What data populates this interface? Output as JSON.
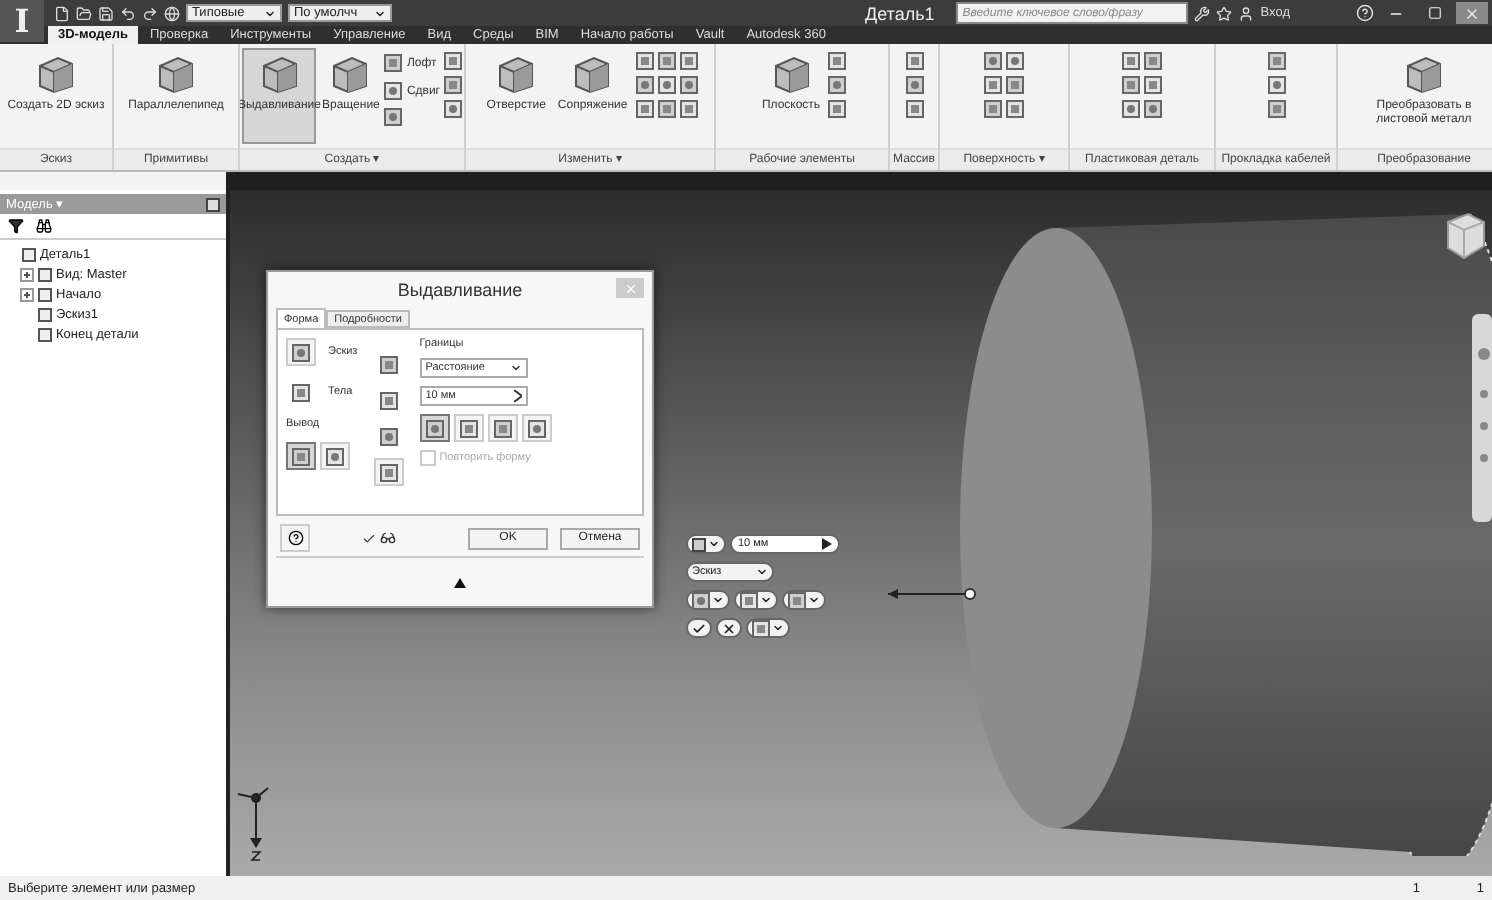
{
  "title_bar": {
    "app_button": "I",
    "style_dropdown": "Типовые",
    "appearance_dropdown": "По умолчч",
    "title": "Деталь1",
    "search": {
      "placeholder": "Введите ключевое слово/фразу"
    },
    "sign_in": "Вход"
  },
  "tabs": [
    {
      "label": "3D-модель",
      "selected": true
    },
    {
      "label": "Проверка",
      "selected": false
    },
    {
      "label": "Инструменты",
      "selected": false
    },
    {
      "label": "Управление",
      "selected": false
    },
    {
      "label": "Вид",
      "selected": false
    },
    {
      "label": "Среды",
      "selected": false
    },
    {
      "label": "BIM",
      "selected": false
    },
    {
      "label": "Начало работы",
      "selected": false
    },
    {
      "label": "Vault",
      "selected": false
    },
    {
      "label": "Autodesk 360",
      "selected": false
    }
  ],
  "ribbon": [
    {
      "title": "Эскиз",
      "items": [
        {
          "kind": "large",
          "label": "Создать 2D эскиз",
          "active": false
        }
      ]
    },
    {
      "title": "Примитивы",
      "items": [
        {
          "kind": "large",
          "label": "Параллелепипед",
          "active": false
        }
      ]
    },
    {
      "title": "Создать ▾",
      "items": [
        {
          "kind": "large",
          "label": "Выдавливание",
          "active": true
        },
        {
          "kind": "large",
          "label": "Вращение",
          "active": false
        },
        {
          "kind": "small",
          "label": "Лофт"
        },
        {
          "kind": "small",
          "label": "Сдвиг"
        },
        {
          "kind": "small"
        },
        {
          "kind": "small"
        },
        {
          "kind": "small"
        },
        {
          "kind": "small"
        }
      ]
    },
    {
      "title": "Изменить ▾",
      "items": [
        {
          "kind": "large",
          "label": "Отверстие",
          "active": false
        },
        {
          "kind": "large",
          "label": "Сопряжение",
          "active": false
        },
        {
          "kind": "small"
        },
        {
          "kind": "small"
        },
        {
          "kind": "small"
        },
        {
          "kind": "small"
        },
        {
          "kind": "small"
        },
        {
          "kind": "small"
        },
        {
          "kind": "small"
        },
        {
          "kind": "small"
        },
        {
          "kind": "small"
        }
      ]
    },
    {
      "title": "Рабочие элементы",
      "items": [
        {
          "kind": "large",
          "label": "Плоскость",
          "active": false
        },
        {
          "kind": "small"
        },
        {
          "kind": "small"
        },
        {
          "kind": "small"
        }
      ]
    },
    {
      "title": "Массив",
      "items": [
        {
          "kind": "small"
        },
        {
          "kind": "small"
        },
        {
          "kind": "small"
        }
      ]
    },
    {
      "title": "Поверхность ▾",
      "items": [
        {
          "kind": "small"
        },
        {
          "kind": "small"
        },
        {
          "kind": "small"
        },
        {
          "kind": "small"
        },
        {
          "kind": "small"
        },
        {
          "kind": "small"
        }
      ]
    },
    {
      "title": "Пластиковая деталь",
      "items": [
        {
          "kind": "small"
        },
        {
          "kind": "small"
        },
        {
          "kind": "small"
        },
        {
          "kind": "small"
        },
        {
          "kind": "small"
        },
        {
          "kind": "small"
        }
      ]
    },
    {
      "title": "Прокладка кабелей",
      "items": [
        {
          "kind": "small"
        },
        {
          "kind": "small"
        },
        {
          "kind": "small"
        }
      ]
    },
    {
      "title": "Преобразование",
      "items": [
        {
          "kind": "large",
          "label": "Преобразовать в листовой металл",
          "active": false
        }
      ]
    }
  ],
  "browser": {
    "header": "Модель ▾",
    "tree": [
      {
        "label": "Деталь1",
        "children": [
          {
            "label": "Вид: Master",
            "expanded": false
          },
          {
            "label": "Начало",
            "expanded": false
          },
          {
            "label": "Эскиз1"
          },
          {
            "label": "Конец детали"
          }
        ]
      }
    ]
  },
  "dialog": {
    "title": "Выдавливание",
    "tabs": [
      {
        "label": "Форма",
        "selected": true
      },
      {
        "label": "Подробности",
        "selected": false
      }
    ],
    "profile_label": "Эскиз",
    "solids_label": "Тела",
    "output_label": "Вывод",
    "output": [
      {
        "selected": true
      },
      {
        "selected": false
      }
    ],
    "extents_label": "Границы",
    "extents": "Расстояние",
    "distance": "10 мм",
    "directions": [
      {
        "selected": true
      },
      {
        "selected": false
      },
      {
        "selected": false
      },
      {
        "selected": false
      }
    ],
    "match_shape": {
      "label": "Повторить форму",
      "checked": false,
      "disabled": true
    },
    "preview": {
      "checked": true
    },
    "ok": "OK",
    "cancel": "Отмена"
  },
  "mini_toolbar": {
    "distance": "10 мм",
    "profile": "Эскиз"
  },
  "status_bar": {
    "message": "Выберите элемент или размер",
    "counts": [
      "1",
      "1"
    ]
  }
}
